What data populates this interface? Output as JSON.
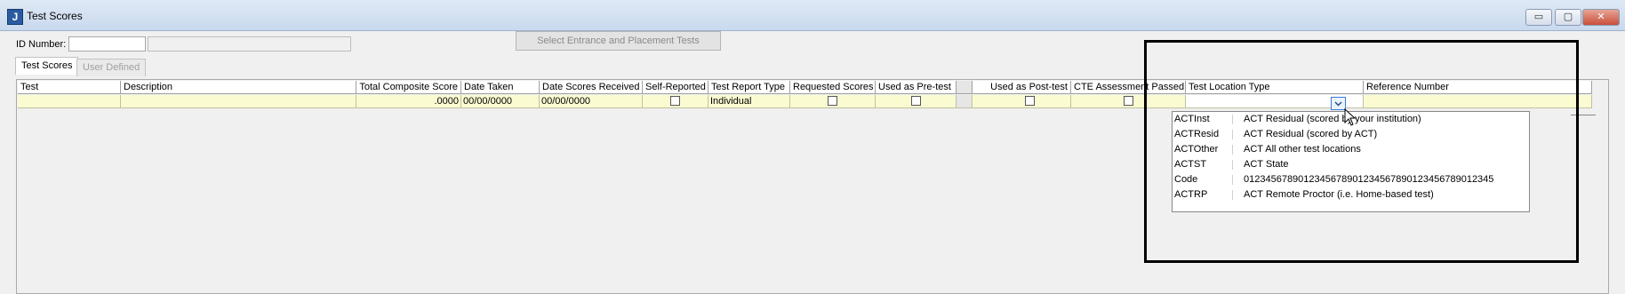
{
  "window": {
    "title": "Test Scores",
    "icon": "J"
  },
  "controls": {
    "minimize": "▭",
    "maximize": "▢",
    "close": "✕"
  },
  "id_number": {
    "label": "ID Number:",
    "value": "",
    "name_value": ""
  },
  "select_tests_button": "Select Entrance and Placement Tests",
  "tabs": [
    {
      "label": "Test Scores",
      "active": true
    },
    {
      "label": "User Defined",
      "active": false
    }
  ],
  "columns": {
    "test": "Test",
    "description": "Description",
    "total_composite_score": "Total Composite Score",
    "date_taken": "Date Taken",
    "date_scores_received": "Date Scores Received",
    "self_reported": "Self-Reported",
    "test_report_type": "Test Report Type",
    "requested_scores": "Requested Scores",
    "used_as_pretest": "Used as Pre-test",
    "used_as_posttest": "Used as Post-test",
    "cte_assessment_passed": "CTE Assessment Passed",
    "test_location_type": "Test Location Type",
    "reference_number": "Reference Number"
  },
  "row": {
    "test": "",
    "description": "",
    "total_composite_score": ".0000",
    "date_taken": "00/00/0000",
    "date_scores_received": "00/00/0000",
    "test_report_type": "Individual",
    "test_location_type": "",
    "reference_number": ""
  },
  "location_options": [
    {
      "code": "ACTInst",
      "description": "ACT Residual (scored by your institution)"
    },
    {
      "code": "ACTResid",
      "description": "ACT Residual (scored by ACT)"
    },
    {
      "code": "ACTOther",
      "description": "ACT All other test locations"
    },
    {
      "code": "ACTST",
      "description": "ACT State"
    },
    {
      "code": "Code",
      "description": "0123456789012345678901234567890123456789012345"
    },
    {
      "code": "ACTRP",
      "description": "ACT Remote Proctor (i.e. Home-based test)"
    }
  ]
}
